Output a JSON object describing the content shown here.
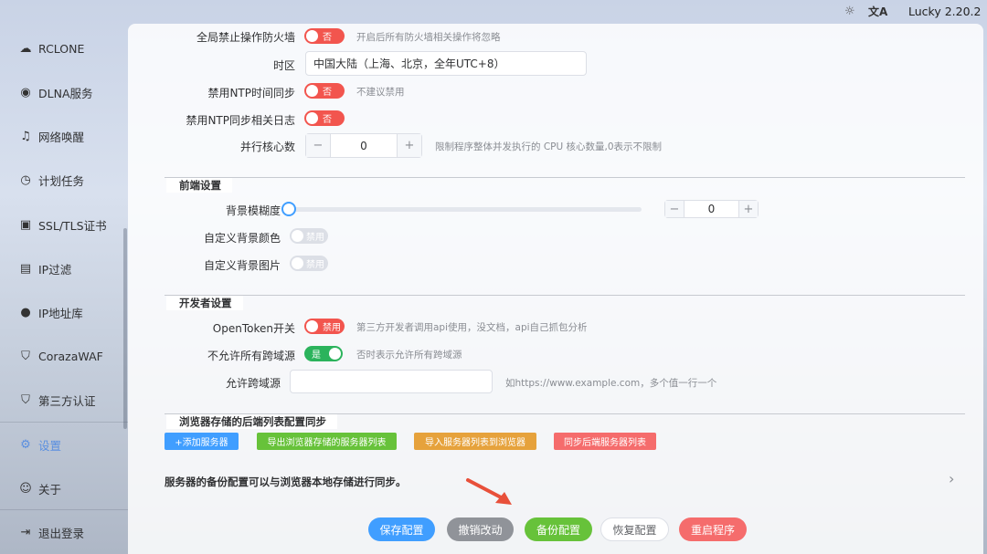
{
  "topbar": {
    "theme_icon": "☼",
    "lang_icon": "文A",
    "version": "Lucky 2.20.2"
  },
  "sidebar": {
    "items": [
      {
        "label": "RCLONE",
        "icon": "rclone-icon",
        "glyph": "☁"
      },
      {
        "label": "DLNA服务",
        "icon": "dlna-icon",
        "glyph": "◉"
      },
      {
        "label": "网络唤醒",
        "icon": "bell-icon",
        "glyph": "♫"
      },
      {
        "label": "计划任务",
        "icon": "clock-icon",
        "glyph": "◷"
      },
      {
        "label": "SSL/TLS证书",
        "icon": "certificate-icon",
        "glyph": "▣"
      },
      {
        "label": "IP过滤",
        "icon": "ip-filter-icon",
        "glyph": "▤"
      },
      {
        "label": "IP地址库",
        "icon": "user-icon",
        "glyph": "●"
      },
      {
        "label": "CorazaWAF",
        "icon": "shield-icon",
        "glyph": "⛉"
      },
      {
        "label": "第三方认证",
        "icon": "auth-shield-icon",
        "glyph": "⛉"
      },
      {
        "label": "设置",
        "icon": "settings-icon",
        "glyph": "⚙"
      },
      {
        "label": "关于",
        "icon": "about-icon",
        "glyph": "☺"
      },
      {
        "label": "退出登录",
        "icon": "logout-icon",
        "glyph": "⇥"
      }
    ],
    "accent": "#5a8fe0"
  },
  "settings": {
    "firewall": {
      "label": "全局禁止操作防火墙",
      "state": "否",
      "hint": "开启后所有防火墙相关操作将忽略"
    },
    "timezone": {
      "label": "时区",
      "value": "中国大陆（上海、北京，全年UTC+8）"
    },
    "ntp_sync": {
      "label": "禁用NTP时间同步",
      "state": "否",
      "hint": "不建议禁用"
    },
    "ntp_log": {
      "label": "禁用NTP同步相关日志",
      "state": "否"
    },
    "cores": {
      "label": "并行核心数",
      "value": "0",
      "minus": "−",
      "plus": "+",
      "hint": "限制程序整体并发执行的 CPU 核心数量,0表示不限制"
    }
  },
  "frontend": {
    "title": "前端设置",
    "blur": {
      "label": "背景模糊度",
      "value": "0",
      "minus": "−",
      "plus": "+"
    },
    "bg_color": {
      "label": "自定义背景颜色",
      "state": "禁用"
    },
    "bg_image": {
      "label": "自定义背景图片",
      "state": "禁用"
    }
  },
  "developer": {
    "title": "开发者设置",
    "opentoken": {
      "label": "OpenToken开关",
      "state": "禁用",
      "hint": "第三方开发者调用api使用，没文档，api自己抓包分析"
    },
    "cors_all": {
      "label": "不允许所有跨域源",
      "state": "是",
      "hint": "否时表示允许所有跨域源"
    },
    "cors_origins": {
      "label": "允许跨域源",
      "placeholder": "",
      "hint": "如https://www.example.com，多个值一行一个"
    }
  },
  "sync": {
    "title": "浏览器存储的后端列表配置同步",
    "buttons": [
      {
        "label": "+添加服务器",
        "color": "#409eff"
      },
      {
        "label": "导出浏览器存储的服务器列表",
        "color": "#67c23a"
      },
      {
        "label": "导入服务器列表到浏览器",
        "color": "#e6a23c"
      },
      {
        "label": "同步后端服务器列表",
        "color": "#f56c6c"
      }
    ],
    "note": "服务器的备份配置可以与浏览器本地存储进行同步。",
    "chevron": "›"
  },
  "actions": [
    {
      "label": "保存配置",
      "color": "#409eff"
    },
    {
      "label": "撤销改动",
      "color": "#909399"
    },
    {
      "label": "备份配置",
      "color": "#67c23a"
    },
    {
      "label": "恢复配置",
      "color": "#ffffff"
    },
    {
      "label": "重启程序",
      "color": "#f56c6c"
    }
  ]
}
